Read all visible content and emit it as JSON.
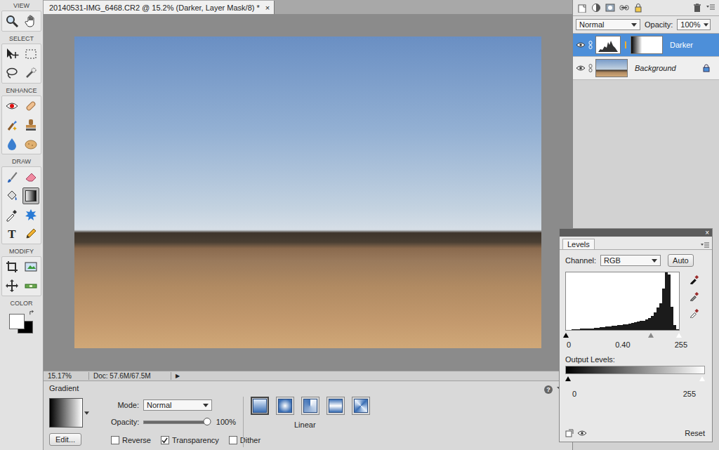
{
  "toolbar": {
    "sections": [
      {
        "label": "VIEW",
        "tools": [
          {
            "kind": "zoom",
            "selected": false
          },
          {
            "kind": "hand",
            "selected": false
          }
        ]
      },
      {
        "label": "SELECT",
        "tools": [
          {
            "kind": "move",
            "selected": false
          },
          {
            "kind": "marquee",
            "selected": false
          },
          {
            "kind": "lasso",
            "selected": false
          },
          {
            "kind": "quickselect",
            "selected": false
          }
        ]
      },
      {
        "label": "ENHANCE",
        "tools": [
          {
            "kind": "redeye",
            "selected": false
          },
          {
            "kind": "spotheal",
            "selected": false
          },
          {
            "kind": "smartbrush",
            "selected": false
          },
          {
            "kind": "clone",
            "selected": false
          },
          {
            "kind": "blur",
            "selected": false
          },
          {
            "kind": "sponge",
            "selected": false
          }
        ]
      },
      {
        "label": "DRAW",
        "tools": [
          {
            "kind": "brush",
            "selected": false
          },
          {
            "kind": "eraser",
            "selected": false
          },
          {
            "kind": "bucket",
            "selected": false
          },
          {
            "kind": "gradient",
            "selected": true
          },
          {
            "kind": "eyedropper",
            "selected": false
          },
          {
            "kind": "shape",
            "selected": false
          },
          {
            "kind": "type",
            "selected": false,
            "glyph": "T"
          },
          {
            "kind": "pencil",
            "selected": false
          }
        ]
      },
      {
        "label": "MODIFY",
        "tools": [
          {
            "kind": "crop",
            "selected": false
          },
          {
            "kind": "recompose",
            "selected": false
          },
          {
            "kind": "contentmove",
            "selected": false
          },
          {
            "kind": "straighten",
            "selected": false
          }
        ]
      }
    ],
    "color_label": "COLOR"
  },
  "document": {
    "tab_title": "20140531-IMG_6468.CR2 @ 15.2% (Darker, Layer Mask/8) *",
    "close": "×"
  },
  "status_bar": {
    "zoom": "15.17%",
    "doc_size": "Doc: 57.6M/67.5M",
    "menu_arrow": "▶"
  },
  "tool_options": {
    "tool": "Gradient",
    "edit_button": "Edit...",
    "mode_label": "Mode:",
    "mode": "Normal",
    "opacity_label": "Opacity:",
    "opacity_level": 1,
    "opacity": "100%",
    "checkboxes": [
      {
        "label": "Reverse",
        "checked": false
      },
      {
        "label": "Transparency",
        "checked": true
      },
      {
        "label": "Dither",
        "checked": false
      }
    ],
    "gradient_types": [
      {
        "kind": "linear",
        "selected": true
      },
      {
        "kind": "radial",
        "selected": false
      },
      {
        "kind": "angle",
        "selected": false
      },
      {
        "kind": "reflected",
        "selected": false
      },
      {
        "kind": "diamond",
        "selected": false
      }
    ],
    "type_label": "Linear",
    "help": "?"
  },
  "layers_panel": {
    "blend_mode": "Normal",
    "opacity_label": "Opacity:",
    "opacity": "100%",
    "layers": [
      {
        "name": "Darker",
        "kind": "adjustment",
        "selected": true,
        "visible": true
      },
      {
        "name": "Background",
        "kind": "photo",
        "selected": false,
        "visible": true
      }
    ]
  },
  "levels_panel": {
    "close": "×",
    "tab": "Levels",
    "channel_label": "Channel:",
    "channel": "RGB",
    "auto_button": "Auto",
    "histogram": [
      0,
      0,
      1,
      1,
      1,
      2,
      2,
      2,
      3,
      3,
      4,
      4,
      5,
      5,
      6,
      6,
      7,
      7,
      8,
      8,
      9,
      10,
      11,
      12,
      13,
      14,
      15,
      16,
      18,
      20,
      24,
      30,
      38,
      45,
      70,
      98,
      95,
      40,
      8,
      1
    ],
    "input_sliders": [
      {
        "level": 0
      },
      {
        "level": 0.75
      },
      {
        "level": 1
      }
    ],
    "input_values": [
      "0",
      "0.40",
      "255"
    ],
    "output_label": "Output Levels:",
    "output_sliders": [
      {
        "level": 0
      },
      {
        "level": 1
      }
    ],
    "output_values": [
      "0",
      "255"
    ],
    "reset_button": "Reset"
  }
}
